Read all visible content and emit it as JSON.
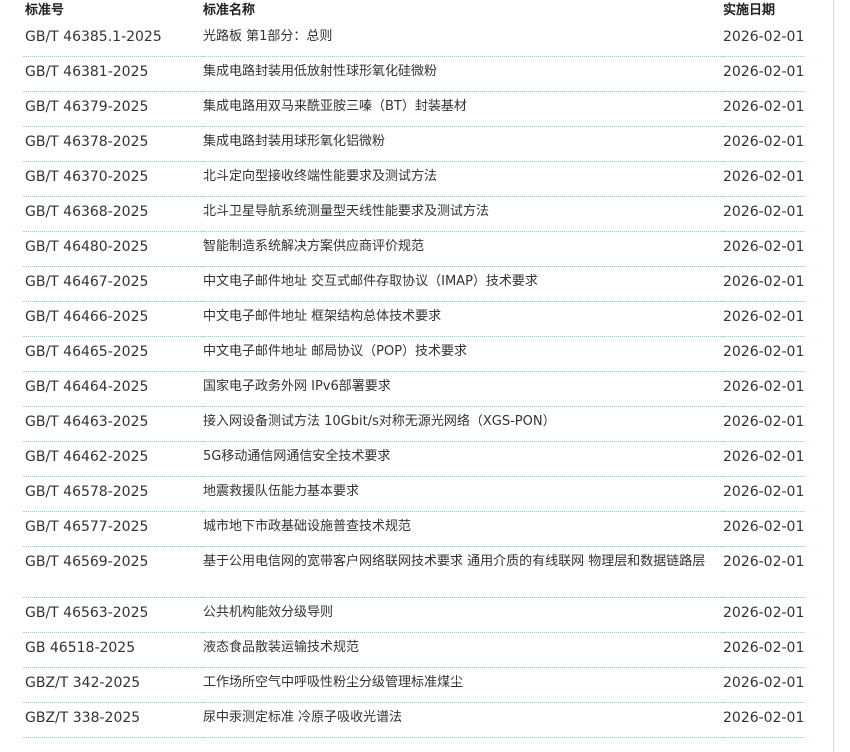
{
  "table": {
    "headers": {
      "code": "标准号",
      "name": "标准名称",
      "date": "实施日期"
    },
    "rows": [
      {
        "code": "GB/T 46385.1-2025",
        "name": "光路板 第1部分：总则",
        "date": "2026-02-01"
      },
      {
        "code": "GB/T 46381-2025",
        "name": "集成电路封装用低放射性球形氧化硅微粉",
        "date": "2026-02-01"
      },
      {
        "code": "GB/T 46379-2025",
        "name": "集成电路用双马来酰亚胺三嗪（BT）封装基材",
        "date": "2026-02-01"
      },
      {
        "code": "GB/T 46378-2025",
        "name": "集成电路封装用球形氧化铝微粉",
        "date": "2026-02-01"
      },
      {
        "code": "GB/T 46370-2025",
        "name": "北斗定向型接收终端性能要求及测试方法",
        "date": "2026-02-01"
      },
      {
        "code": "GB/T 46368-2025",
        "name": "北斗卫星导航系统测量型天线性能要求及测试方法",
        "date": "2026-02-01"
      },
      {
        "code": "GB/T 46480-2025",
        "name": "智能制造系统解决方案供应商评价规范",
        "date": "2026-02-01"
      },
      {
        "code": "GB/T 46467-2025",
        "name": "中文电子邮件地址 交互式邮件存取协议（IMAP）技术要求",
        "date": "2026-02-01"
      },
      {
        "code": "GB/T 46466-2025",
        "name": "中文电子邮件地址 框架结构总体技术要求",
        "date": "2026-02-01"
      },
      {
        "code": "GB/T 46465-2025",
        "name": "中文电子邮件地址 邮局协议（POP）技术要求",
        "date": "2026-02-01"
      },
      {
        "code": "GB/T 46464-2025",
        "name": "国家电子政务外网 IPv6部署要求",
        "date": "2026-02-01"
      },
      {
        "code": "GB/T 46463-2025",
        "name": "接入网设备测试方法 10Gbit/s对称无源光网络（XGS-PON）",
        "date": "2026-02-01"
      },
      {
        "code": "GB/T 46462-2025",
        "name": "5G移动通信网通信安全技术要求",
        "date": "2026-02-01"
      },
      {
        "code": "GB/T 46578-2025",
        "name": "地震救援队伍能力基本要求",
        "date": "2026-02-01"
      },
      {
        "code": "GB/T 46577-2025",
        "name": "城市地下市政基础设施普查技术规范",
        "date": "2026-02-01"
      },
      {
        "code": "GB/T 46569-2025",
        "name": "基于公用电信网的宽带客户网络联网技术要求 通用介质的有线联网 物理层和数据链路层",
        "date": "2026-02-01"
      },
      {
        "code": "GB/T 46563-2025",
        "name": "公共机构能效分级导则",
        "date": "2026-02-01"
      },
      {
        "code": "GB 46518-2025",
        "name": "液态食品散装运输技术规范",
        "date": "2026-02-01"
      },
      {
        "code": "GBZ/T 342-2025",
        "name": "工作场所空气中呼吸性粉尘分级管理标准煤尘",
        "date": "2026-02-01"
      },
      {
        "code": "GBZ/T 338-2025",
        "name": "尿中汞测定标准 冷原子吸收光谱法",
        "date": "2026-02-01"
      }
    ]
  }
}
